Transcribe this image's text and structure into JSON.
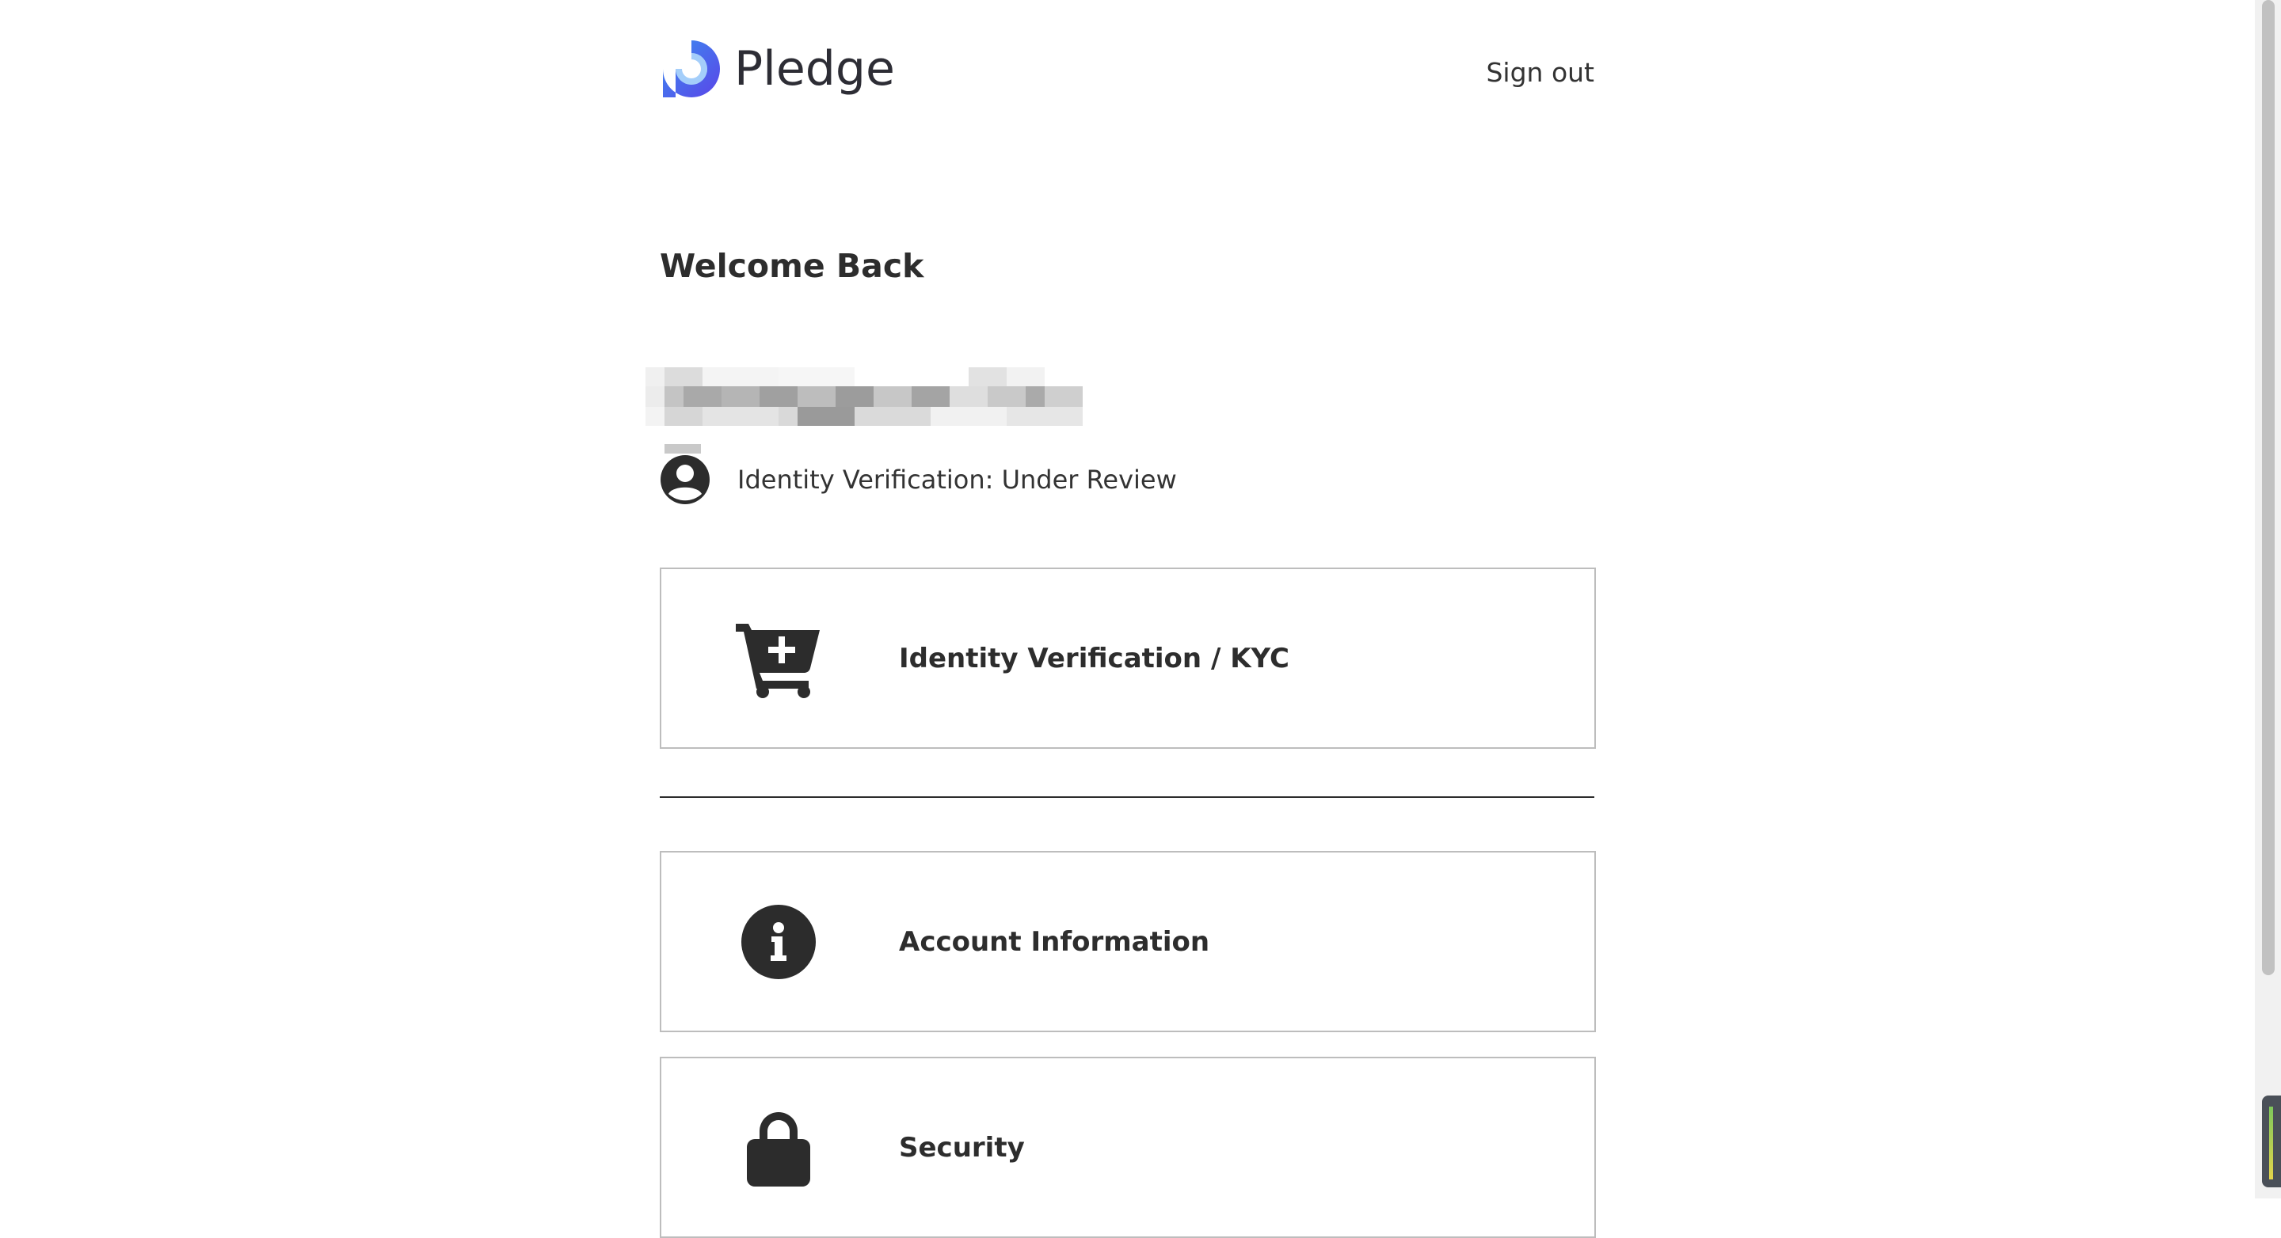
{
  "brand": {
    "name": "Pledge",
    "accent": "#3b6fe6",
    "accent_secondary": "#5a45e8"
  },
  "header": {
    "signout_label": "Sign out"
  },
  "welcome": {
    "title": "Welcome Back"
  },
  "status": {
    "icon": "user-circle-icon",
    "text": "Identity Verification: Under Review"
  },
  "cards": [
    {
      "icon": "cart-plus-icon",
      "label": "Identity Verification / KYC"
    },
    {
      "icon": "info-circle-icon",
      "label": "Account Information"
    },
    {
      "icon": "lock-icon",
      "label": "Security"
    }
  ]
}
